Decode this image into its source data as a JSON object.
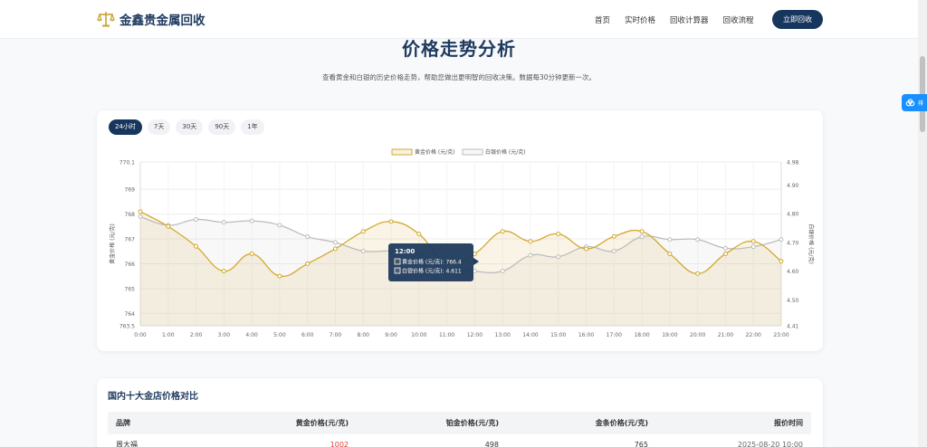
{
  "brand": {
    "name": "金鑫贵金属回收",
    "logo_icon": "scale-icon",
    "accent": "#c8a233"
  },
  "nav": {
    "items": [
      "首页",
      "实时价格",
      "回收计算器",
      "回收流程"
    ],
    "cta": "立即回收",
    "cta_color": "#17365d"
  },
  "header": {
    "title": "价格走势分析",
    "subtitle": "查看黄金和白银的历史价格走势，帮助您做出更明智的回收决策。数据每30分钟更新一次。"
  },
  "float_button": {
    "icon": "cloud-icon",
    "label": "排"
  },
  "periods": {
    "options": [
      "24小时",
      "7天",
      "30天",
      "90天",
      "1年"
    ],
    "active_index": 0
  },
  "chart_data": {
    "type": "line",
    "x": [
      "0:00",
      "1:00",
      "2:00",
      "3:00",
      "4:00",
      "5:00",
      "6:00",
      "7:00",
      "8:00",
      "9:00",
      "10:00",
      "11:00",
      "12:00",
      "13:00",
      "14:00",
      "15:00",
      "16:00",
      "17:00",
      "18:00",
      "19:00",
      "20:00",
      "21:00",
      "22:00",
      "23:00"
    ],
    "series": [
      {
        "name": "黄金价格 (元/克)",
        "axis": "left",
        "color": "#d4a82e",
        "values": [
          768.1,
          767.5,
          766.7,
          765.7,
          766.4,
          765.5,
          766.0,
          766.6,
          767.3,
          767.7,
          767.2,
          766.0,
          766.4,
          767.3,
          766.9,
          767.2,
          766.6,
          767.1,
          767.3,
          766.4,
          765.6,
          766.4,
          766.9,
          766.1
        ]
      },
      {
        "name": "白银价格 (元/克)",
        "axis": "right",
        "color": "#bdbdbd",
        "values": [
          4.79,
          4.76,
          4.78,
          4.77,
          4.775,
          4.76,
          4.72,
          4.7,
          4.67,
          4.67,
          4.66,
          4.615,
          4.6,
          4.6,
          4.655,
          4.65,
          4.685,
          4.67,
          4.72,
          4.71,
          4.71,
          4.68,
          4.685,
          4.71
        ]
      }
    ],
    "left_axis": {
      "label": "黄金价格 (元/克)",
      "ticks": [
        "770.1",
        "769",
        "768",
        "767",
        "766",
        "765",
        "764",
        "763.5"
      ],
      "range": [
        763.5,
        770.1
      ]
    },
    "right_axis": {
      "label": "白银价格 (元/克)",
      "ticks": [
        "4.98",
        "4.90",
        "4.80",
        "4.70",
        "4.60",
        "4.50",
        "4.41"
      ],
      "range": [
        4.41,
        4.98
      ]
    },
    "grid": true,
    "legend": "top-center",
    "tooltip": {
      "title": "12:00",
      "lines": [
        "黄金价格 (元/克): 766.4",
        "白银价格 (元/克): 4.611"
      ],
      "index": 11
    }
  },
  "comparison": {
    "title": "国内十大金店价格对比",
    "columns": [
      "品牌",
      "黄金价格(元/克)",
      "铂金价格(元/克)",
      "金条价格(元/克)",
      "报价时间"
    ],
    "rows": [
      [
        "周大福",
        "1002",
        "498",
        "765",
        "2025-08-20 10:00"
      ]
    ]
  }
}
